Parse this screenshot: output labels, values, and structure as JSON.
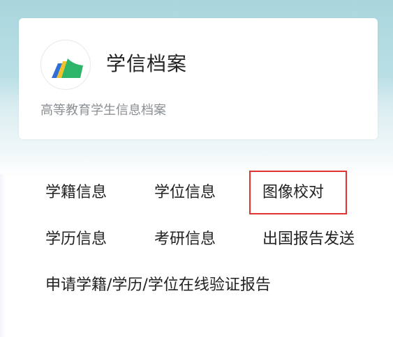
{
  "card": {
    "title": "学信档案",
    "subtitle": "高等教育学生信息档案",
    "logo_icon": "chsi-logo-icon"
  },
  "menu": {
    "row1": [
      "学籍信息",
      "学位信息",
      "图像校对"
    ],
    "row2": [
      "学历信息",
      "考研信息",
      "出国报告发送"
    ],
    "row3": [
      "申请学籍/学历/学位在线验证报告"
    ]
  },
  "highlighted_item": "图像校对",
  "colors": {
    "highlight_border": "#e23232",
    "logo_green": "#2fb56a",
    "logo_yellow": "#f2c12e",
    "logo_blue": "#2f6fd6"
  }
}
